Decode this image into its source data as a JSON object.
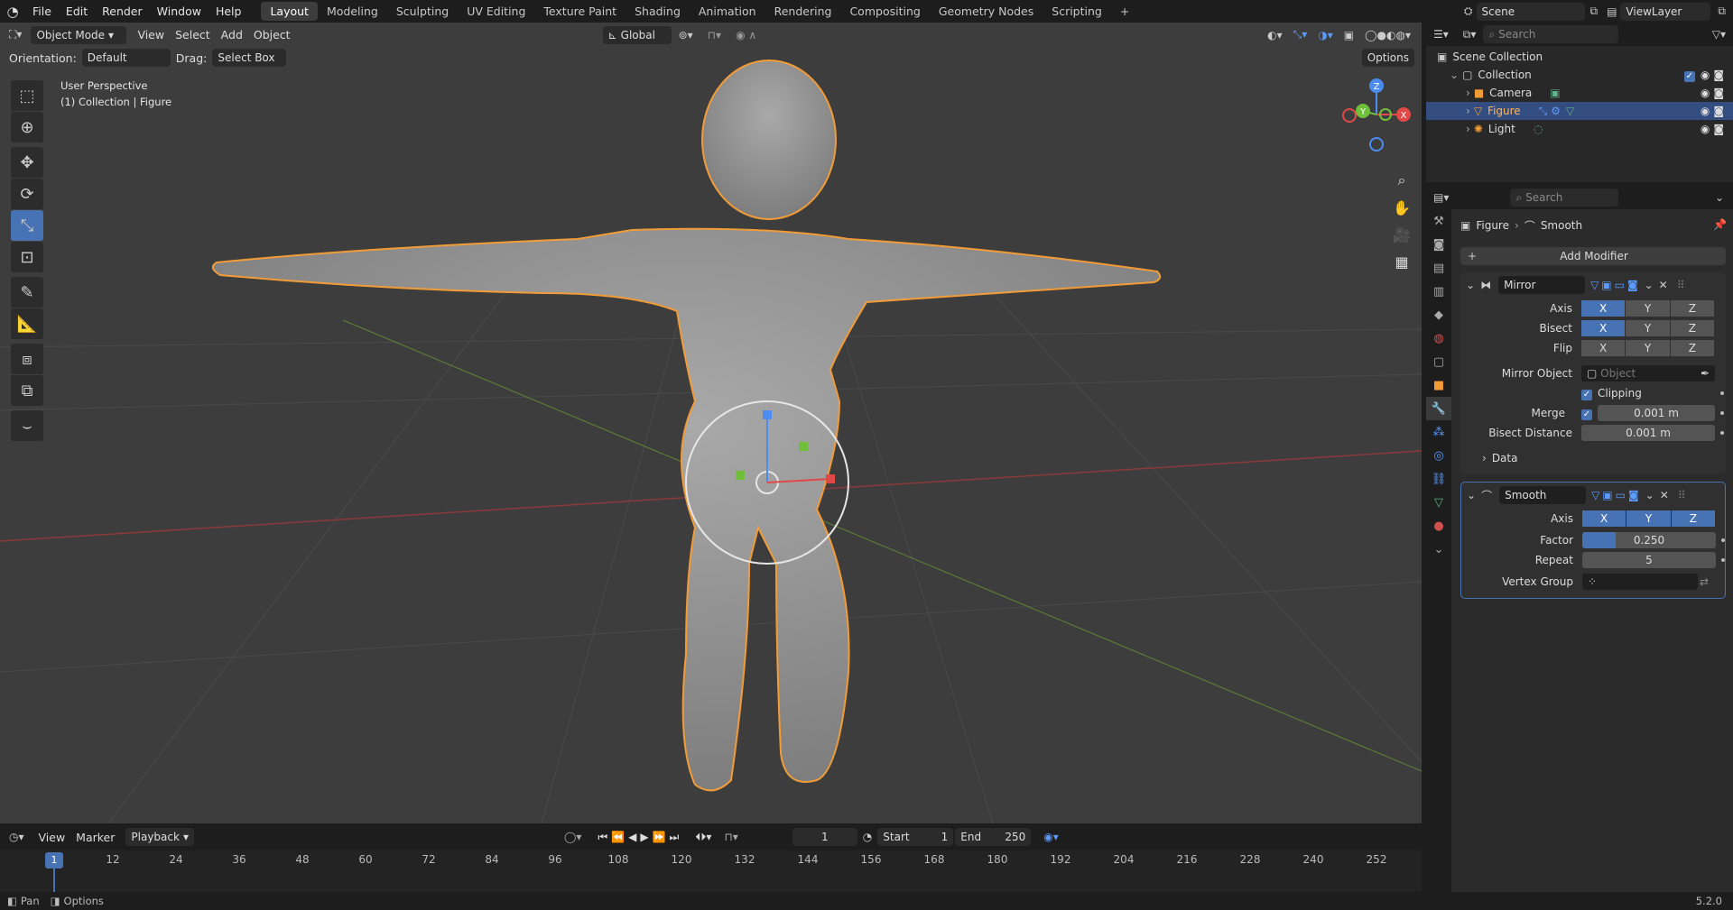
{
  "menu": [
    "File",
    "Edit",
    "Render",
    "Window",
    "Help"
  ],
  "workspaces": [
    "Layout",
    "Modeling",
    "Sculpting",
    "UV Editing",
    "Texture Paint",
    "Shading",
    "Animation",
    "Rendering",
    "Compositing",
    "Geometry Nodes",
    "Scripting"
  ],
  "active_workspace": "Layout",
  "scene": "Scene",
  "view_layer": "ViewLayer",
  "viewport": {
    "mode": "Object Mode",
    "menus": [
      "View",
      "Select",
      "Add",
      "Object"
    ],
    "transform": "Global",
    "orientation_label": "Orientation:",
    "orientation_value": "Default",
    "drag_label": "Drag:",
    "drag_value": "Select Box",
    "options": "Options",
    "overlay_line1": "User Perspective",
    "overlay_line2": "(1) Collection | Figure",
    "gizmo": {
      "x": "X",
      "y": "Y",
      "z": "Z"
    }
  },
  "timeline": {
    "menus": [
      "View",
      "Marker",
      "Playback"
    ],
    "current_frame": "1",
    "start_label": "Start",
    "start": "1",
    "end_label": "End",
    "end": "250",
    "ticks": [
      "1",
      "12",
      "24",
      "36",
      "48",
      "60",
      "72",
      "84",
      "96",
      "108",
      "120",
      "132",
      "144",
      "156",
      "168",
      "180",
      "192",
      "204",
      "216",
      "228",
      "240",
      "252"
    ]
  },
  "status": {
    "pan": "Pan",
    "options": "Options",
    "version": "5.2.0"
  },
  "outliner": {
    "search_placeholder": "Search",
    "scene_collection": "Scene Collection",
    "collection": "Collection",
    "items": [
      "Camera",
      "Figure",
      "Light"
    ]
  },
  "properties": {
    "search_placeholder": "Search",
    "breadcrumb_object": "Figure",
    "breadcrumb_modifier": "Smooth",
    "add_modifier": "Add Modifier",
    "mirror": {
      "name": "Mirror",
      "axis_label": "Axis",
      "bisect_label": "Bisect",
      "flip_label": "Flip",
      "x": "X",
      "y": "Y",
      "z": "Z",
      "mirror_object_label": "Mirror Object",
      "mirror_object_placeholder": "Object",
      "clipping_label": "Clipping",
      "merge_label": "Merge",
      "merge_value": "0.001 m",
      "bisect_distance_label": "Bisect Distance",
      "bisect_distance_value": "0.001 m",
      "data_label": "Data"
    },
    "smooth": {
      "name": "Smooth",
      "axis_label": "Axis",
      "x": "X",
      "y": "Y",
      "z": "Z",
      "factor_label": "Factor",
      "factor_value": "0.250",
      "factor_fill": 0.25,
      "repeat_label": "Repeat",
      "repeat_value": "5",
      "vertex_group_label": "Vertex Group"
    }
  },
  "colors": {
    "accent": "#4772b3",
    "selection_outline": "#f29c38",
    "background": "#3d3d3d"
  }
}
